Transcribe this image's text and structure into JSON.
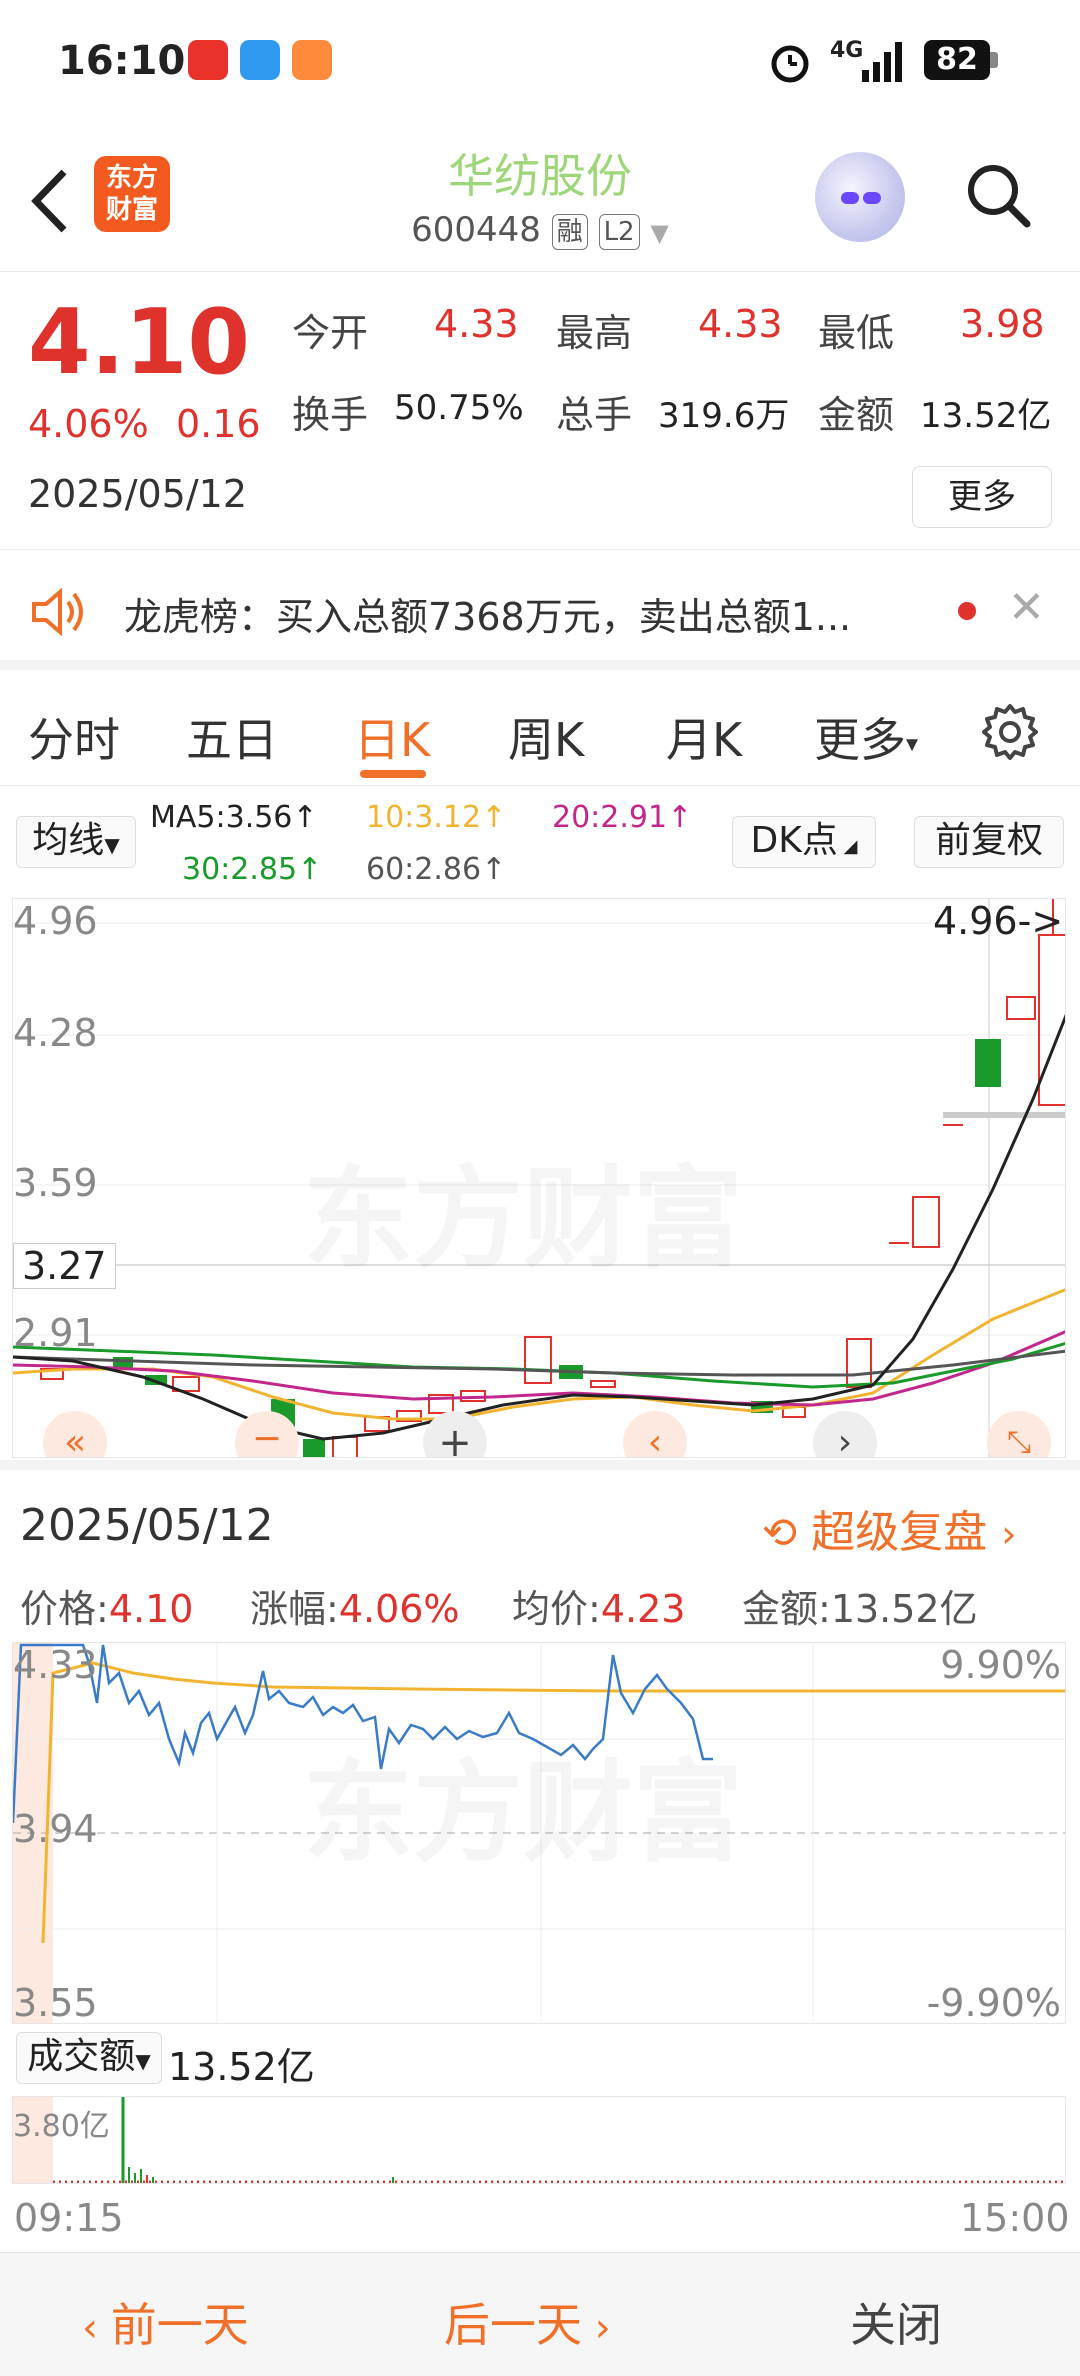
{
  "status": {
    "time": "16:10",
    "network": "4G",
    "battery": "82"
  },
  "header": {
    "title": "华纺股份",
    "code": "600448",
    "tag1": "融",
    "tag2": "L2",
    "logo_line1": "东方",
    "logo_line2": "财富"
  },
  "quote": {
    "price": "4.10",
    "change_pct": "4.06%",
    "change_abs": "0.16",
    "date": "2025/05/12",
    "open_label": "今开",
    "open": "4.33",
    "high_label": "最高",
    "high": "4.33",
    "low_label": "最低",
    "low": "3.98",
    "turnover_label": "换手",
    "turnover": "50.75%",
    "volume_label": "总手",
    "volume": "319.6万",
    "amount_label": "金额",
    "amount": "13.52亿",
    "more": "更多"
  },
  "notice": {
    "text": "龙虎榜：买入总额7368万元，卖出总额1..."
  },
  "tabs": [
    "分时",
    "五日",
    "日K",
    "周K",
    "月K",
    "更多"
  ],
  "ma": {
    "select": "均线",
    "ma5": "MA5:3.56↑",
    "ma10": "10:3.12↑",
    "ma20": "20:2.91↑",
    "ma30": "30:2.85↑",
    "ma60": "60:2.86↑",
    "dk": "DK点",
    "adjust": "前复权",
    "colors": {
      "ma5": "#222222",
      "ma10": "#f2b430",
      "ma20": "#c2278c",
      "ma30": "#1a9a2a",
      "ma60": "#555555"
    }
  },
  "kline": {
    "y_labels": [
      "4.96",
      "4.28",
      "3.59",
      "3.27",
      "2.91"
    ],
    "max_marker": "4.96->",
    "watermark": "东方财富"
  },
  "replay": {
    "date": "2025/05/12",
    "title": "超级复盘",
    "price_label": "价格:",
    "price": "4.10",
    "change_label": "涨幅:",
    "change": "4.06%",
    "avg_label": "均价:",
    "avg": "4.23",
    "amount_label": "金额:",
    "amount": "13.52亿"
  },
  "intraday": {
    "top": "4.33",
    "mid": "3.94",
    "bottom": "3.55",
    "top_pct": "9.90%",
    "bottom_pct": "-9.90%",
    "watermark": "东方财富"
  },
  "volume": {
    "select": "成交额",
    "value": "13.52亿",
    "max": "3.80亿",
    "start": "09:15",
    "end": "15:00"
  },
  "bottom": {
    "prev": "前一天",
    "next": "后一天",
    "close": "关闭"
  }
}
